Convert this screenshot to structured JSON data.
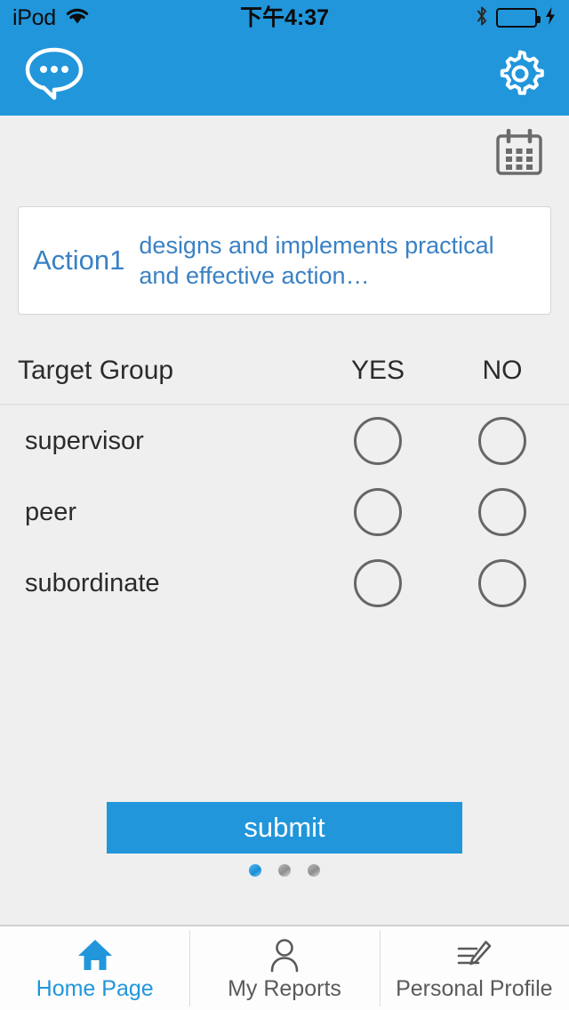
{
  "status_bar": {
    "carrier": "iPod",
    "time": "下午4:37",
    "wifi_icon": "wifi-icon",
    "bluetooth_icon": "bluetooth-icon",
    "battery_icon": "battery-full-charging-icon",
    "battery_color": "#4ce05c"
  },
  "nav_bar": {
    "background": "#2196db",
    "messages_icon": "chat-bubble-icon",
    "settings_icon": "gear-icon"
  },
  "sub_bar": {
    "calendar_icon": "calendar-icon"
  },
  "action_card": {
    "label": "Action1",
    "description": "designs and implements practical and effective action…",
    "text_color": "#3a81c4"
  },
  "table": {
    "headers": {
      "group": "Target Group",
      "yes": "YES",
      "no": "NO"
    },
    "rows": [
      {
        "label": "supervisor",
        "yes_selected": false,
        "no_selected": false
      },
      {
        "label": "peer",
        "yes_selected": false,
        "no_selected": false
      },
      {
        "label": "subordinate",
        "yes_selected": false,
        "no_selected": false
      }
    ]
  },
  "submit": {
    "label": "submit",
    "color": "#2196db"
  },
  "pagination": {
    "total": 3,
    "active_index": 0
  },
  "tab_bar": {
    "items": [
      {
        "label": "Home Page",
        "icon": "home-icon",
        "active": true
      },
      {
        "label": "My Reports",
        "icon": "person-icon",
        "active": false
      },
      {
        "label": "Personal Profile",
        "icon": "edit-icon",
        "active": false
      }
    ],
    "active_color": "#2196db"
  }
}
